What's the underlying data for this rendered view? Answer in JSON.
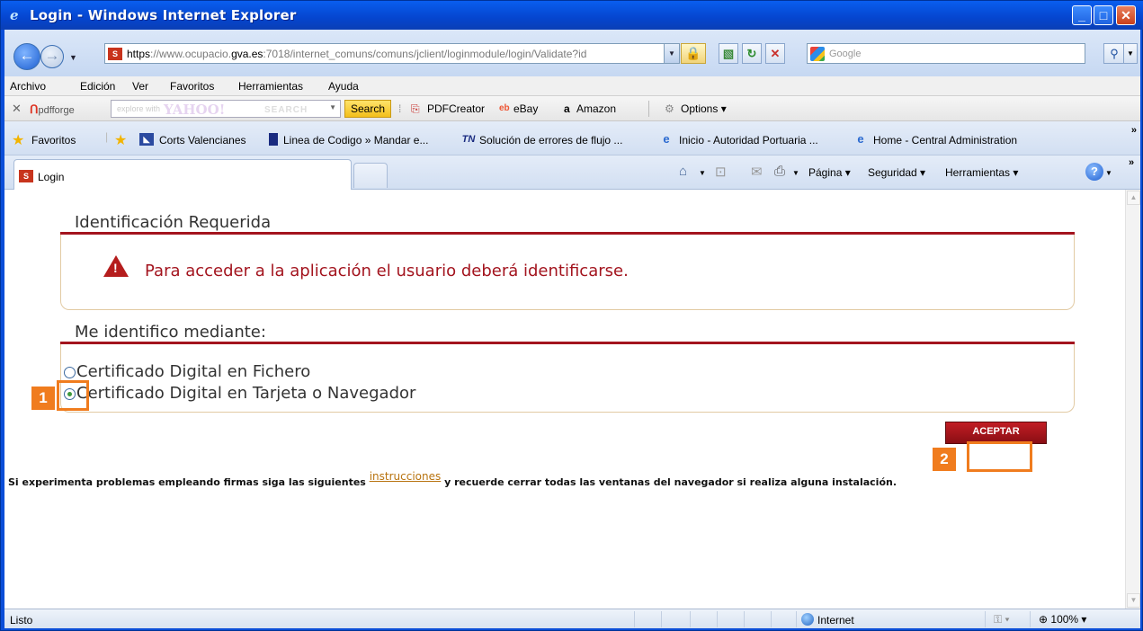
{
  "window": {
    "title": "Login - Windows Internet Explorer"
  },
  "address": {
    "url_https": "https",
    "url_rest_prefix": "://www.ocupacio.",
    "url_host": "gva.es",
    "url_rest": ":7018/internet_comuns/comuns/jclient/loginmodule/login/Validate?id",
    "favicon": "S"
  },
  "search": {
    "placeholder": "Google"
  },
  "menu": {
    "items": [
      "Archivo",
      "Edición",
      "Ver",
      "Favoritos",
      "Herramientas",
      "Ayuda"
    ]
  },
  "pdf_toolbar": {
    "brand": "pdfforge",
    "yahoo_hint": "explore with",
    "yahoo_logo": "YAHOO!",
    "yahoo_search": "SEARCH",
    "search_button": "Search",
    "pdfcreator": "PDFCreator",
    "ebay": "eBay",
    "amazon": "Amazon",
    "options": "Options"
  },
  "favorites": {
    "label": "Favoritos",
    "links": [
      "Corts Valencianes",
      "Linea de Codigo » Mandar e...",
      "Solución de errores de flujo ...",
      "Inicio - Autoridad Portuaria ...",
      "Home - Central Administration"
    ]
  },
  "tabs": {
    "active": "Login"
  },
  "commandbar": {
    "pagina": "Página",
    "seguridad": "Seguridad",
    "herramientas": "Herramientas"
  },
  "page": {
    "section1_title": "Identificación Requerida",
    "warning": "Para acceder a la aplicación el usuario deberá identificarse.",
    "section2_title": "Me identifico mediante:",
    "option1": "Certificado Digital en Fichero",
    "option2": "Certificado Digital en Tarjeta o Navegador",
    "selected_option": 2,
    "accept_button": "ACEPTAR",
    "notice_before": "Si experimenta problemas empleando firmas siga las siguientes",
    "notice_link": "instrucciones",
    "notice_after": "y recuerde cerrar todas las ventanas del navegador si realiza alguna instalación."
  },
  "annotations": {
    "step1": "1",
    "step2": "2",
    "color": "#f07c1e"
  },
  "status": {
    "text": "Listo",
    "zone": "Internet",
    "zoom": "100%"
  },
  "colors": {
    "accent_red": "#a3141e",
    "titlebar_blue": "#0545cf"
  }
}
